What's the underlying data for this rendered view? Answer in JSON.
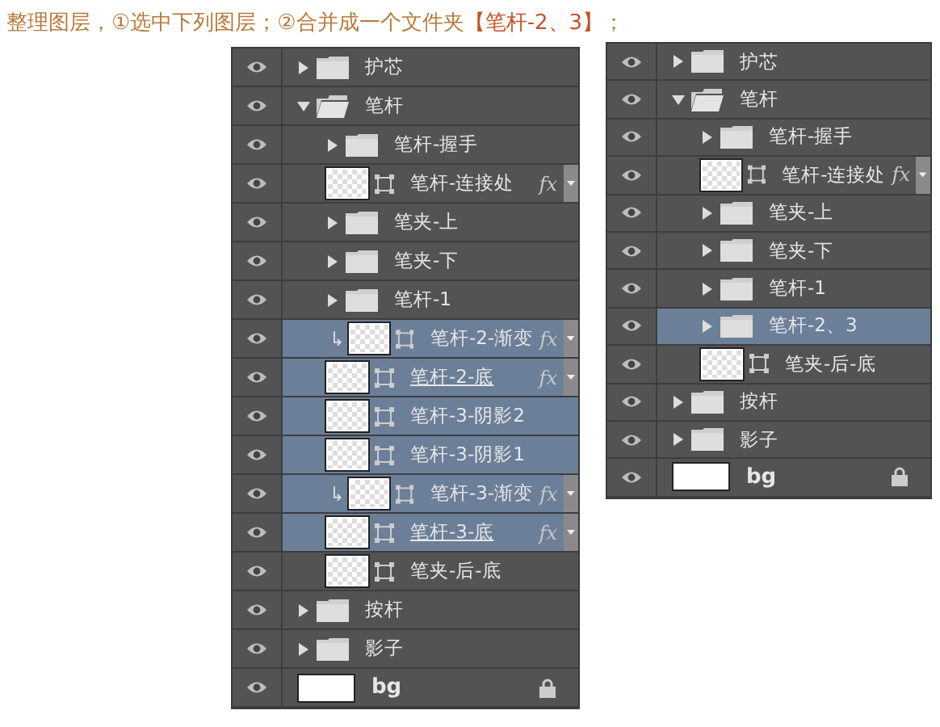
{
  "caption": [
    {
      "text": "整理图层，①选中下列图层；②合并成一个文件夹",
      "highlight": false
    },
    {
      "text": "【笔杆-2、3】",
      "highlight": true
    },
    {
      "text": "；",
      "highlight": false
    }
  ],
  "panels": [
    {
      "layers": [
        {
          "kind": "group",
          "name": "护芯",
          "expanded": false,
          "selected": false
        },
        {
          "kind": "group",
          "name": "笔杆",
          "expanded": true,
          "selected": false,
          "children": [
            {
              "kind": "group",
              "name": "笔杆-握手",
              "expanded": false,
              "selected": false
            },
            {
              "kind": "layer",
              "name": "笔杆-连接处",
              "selected": false,
              "effects_badge": "fx"
            },
            {
              "kind": "group",
              "name": "笔夹-上",
              "expanded": false,
              "selected": false
            },
            {
              "kind": "group",
              "name": "笔夹-下",
              "expanded": false,
              "selected": false
            },
            {
              "kind": "group",
              "name": "笔杆-1",
              "expanded": false,
              "selected": false
            },
            {
              "kind": "layer",
              "name": "笔杆-2-渐变",
              "selected": true,
              "clipped": true,
              "effects_badge": "fx"
            },
            {
              "kind": "layer",
              "name": "笔杆-2-底",
              "selected": true,
              "underlined": true,
              "effects_badge": "fx"
            },
            {
              "kind": "layer",
              "name": "笔杆-3-阴影2",
              "selected": true
            },
            {
              "kind": "layer",
              "name": "笔杆-3-阴影1",
              "selected": true
            },
            {
              "kind": "layer",
              "name": "笔杆-3-渐变",
              "selected": true,
              "clipped": true,
              "effects_badge": "fx"
            },
            {
              "kind": "layer",
              "name": "笔杆-3-底",
              "selected": true,
              "underlined": true,
              "effects_badge": "fx"
            },
            {
              "kind": "layer",
              "name": "笔夹-后-底",
              "selected": false
            }
          ]
        },
        {
          "kind": "group",
          "name": "按杆",
          "expanded": false,
          "selected": false
        },
        {
          "kind": "group",
          "name": "影子",
          "expanded": false,
          "selected": false
        },
        {
          "kind": "fill",
          "name": "bg",
          "selected": false,
          "locked": true
        }
      ]
    },
    {
      "layers": [
        {
          "kind": "group",
          "name": "护芯",
          "expanded": false,
          "selected": false
        },
        {
          "kind": "group",
          "name": "笔杆",
          "expanded": true,
          "selected": false,
          "children": [
            {
              "kind": "group",
              "name": "笔杆-握手",
              "expanded": false,
              "selected": false
            },
            {
              "kind": "layer",
              "name": "笔杆-连接处",
              "selected": false,
              "effects_badge": "fx"
            },
            {
              "kind": "group",
              "name": "笔夹-上",
              "expanded": false,
              "selected": false
            },
            {
              "kind": "group",
              "name": "笔夹-下",
              "expanded": false,
              "selected": false
            },
            {
              "kind": "group",
              "name": "笔杆-1",
              "expanded": false,
              "selected": false
            },
            {
              "kind": "group",
              "name": "笔杆-2、3",
              "expanded": false,
              "selected": true
            },
            {
              "kind": "layer",
              "name": "笔夹-后-底",
              "selected": false
            }
          ]
        },
        {
          "kind": "group",
          "name": "按杆",
          "expanded": false,
          "selected": false
        },
        {
          "kind": "group",
          "name": "影子",
          "expanded": false,
          "selected": false
        },
        {
          "kind": "fill",
          "name": "bg",
          "selected": false,
          "locked": true
        }
      ]
    }
  ]
}
